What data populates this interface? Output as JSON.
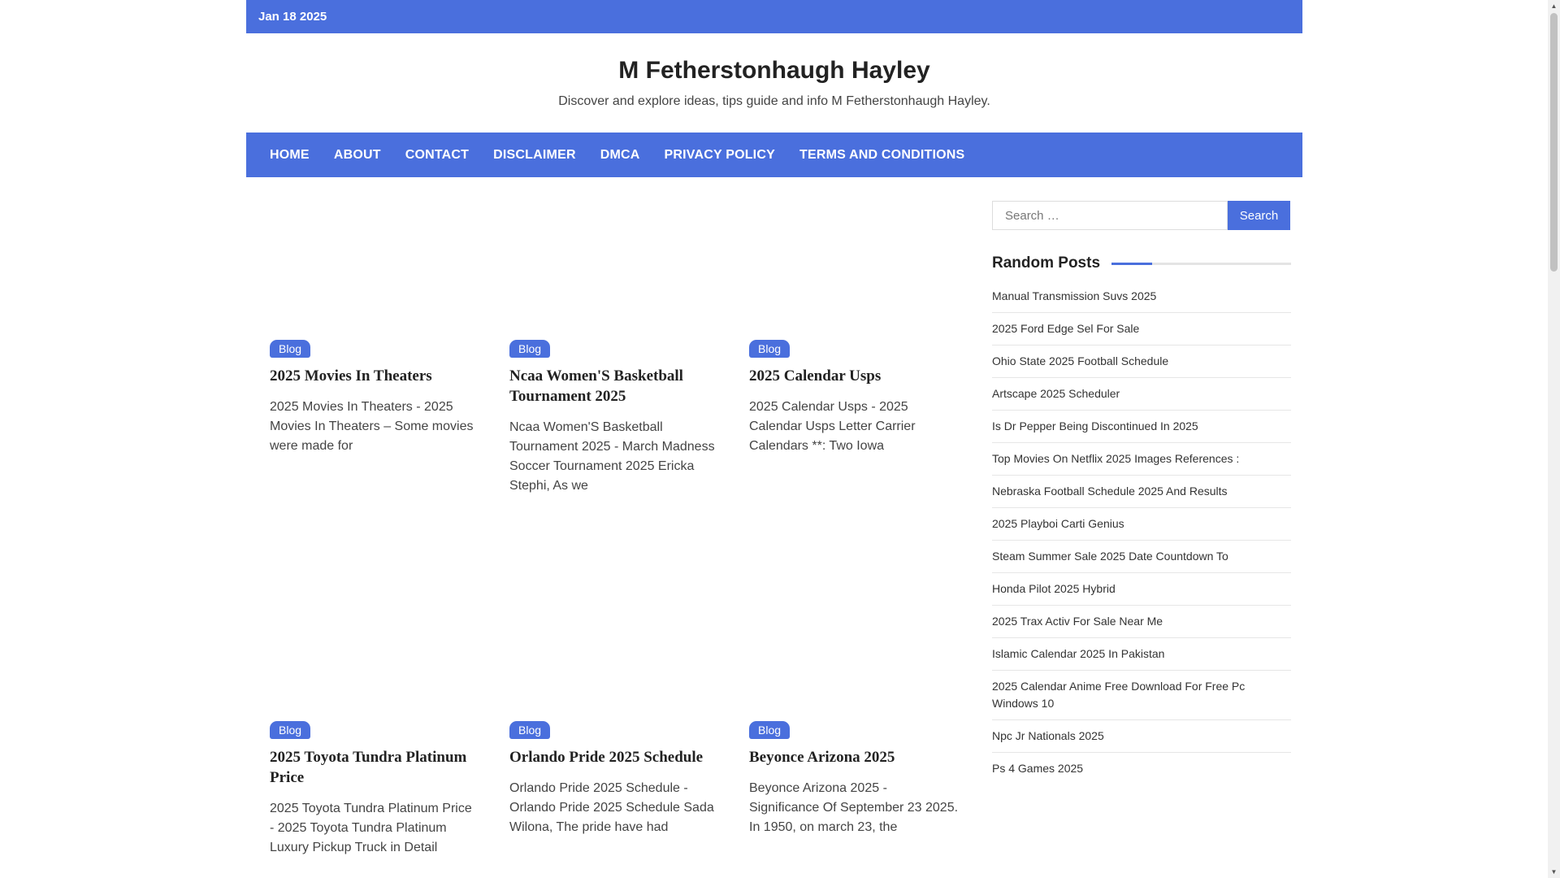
{
  "topbar": {
    "date": "Jan 18 2025"
  },
  "site": {
    "title": "M Fetherstonhaugh Hayley",
    "description": "Discover and explore ideas, tips guide and info M Fetherstonhaugh Hayley."
  },
  "nav": [
    "HOME",
    "ABOUT",
    "CONTACT",
    "DISCLAIMER",
    "DMCA",
    "PRIVACY POLICY",
    "TERMS AND CONDITIONS"
  ],
  "posts": [
    {
      "category": "Blog",
      "title": "2025 Movies In Theaters",
      "excerpt": "2025 Movies In Theaters - 2025 Movies In Theaters – Some movies were made for"
    },
    {
      "category": "Blog",
      "title": "Ncaa Women'S Basketball Tournament 2025",
      "excerpt": "Ncaa Women'S Basketball Tournament 2025 - March Madness Soccer Tournament 2025 Ericka Stephi, As we"
    },
    {
      "category": "Blog",
      "title": "2025 Calendar Usps",
      "excerpt": "2025 Calendar Usps - 2025 Calendar Usps Letter Carrier Calendars **: Two Iowa"
    },
    {
      "category": "Blog",
      "title": "2025 Toyota Tundra Platinum Price",
      "excerpt": "2025 Toyota Tundra Platinum Price - 2025 Toyota Tundra Platinum Luxury Pickup Truck in Detail"
    },
    {
      "category": "Blog",
      "title": "Orlando Pride 2025 Schedule",
      "excerpt": "Orlando Pride 2025 Schedule - Orlando Pride 2025 Schedule Sada Wilona, The pride have had"
    },
    {
      "category": "Blog",
      "title": "Beyonce Arizona 2025",
      "excerpt": "Beyonce Arizona 2025 - Significance Of September 23 2025. In 1950, on march 23, the"
    }
  ],
  "sidebar": {
    "search_placeholder": "Search …",
    "search_button": "Search",
    "random_title": "Random Posts",
    "random_posts": [
      "Manual Transmission Suvs 2025",
      "2025 Ford Edge Sel For Sale",
      "Ohio State 2025 Football Schedule",
      "Artscape 2025 Scheduler",
      "Is Dr Pepper Being Discontinued In 2025",
      "Top Movies On Netflix 2025 Images References :",
      "Nebraska Football Schedule 2025 And Results",
      "2025 Playboi Carti Genius",
      "Steam Summer Sale 2025 Date Countdown To",
      "Honda Pilot 2025 Hybrid",
      "2025 Trax Activ For Sale Near Me",
      "Islamic Calendar 2025 In Pakistan",
      "2025 Calendar Anime Free Download For Free Pc Windows 10",
      "Npc Jr Nationals 2025",
      "Ps 4 Games 2025"
    ]
  },
  "colors": {
    "accent": "#4a6fdd"
  }
}
